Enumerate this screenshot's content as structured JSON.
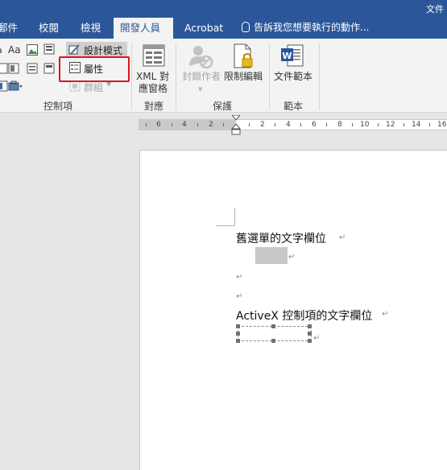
{
  "window": {
    "doc_title_fragment": "文件"
  },
  "tabs": [
    {
      "label": "郵件"
    },
    {
      "label": "校閱"
    },
    {
      "label": "檢視"
    },
    {
      "label": "開發人員",
      "active": true
    },
    {
      "label": "Acrobat"
    }
  ],
  "tell_me": {
    "text": "告訴我您想要執行的動作..."
  },
  "ribbon": {
    "controls": {
      "design_mode": "設計模式",
      "properties": "屬性",
      "group": "群組",
      "label": "控制項"
    },
    "mapping": {
      "xml_pane_line1": "XML 對",
      "xml_pane_line2": "應窗格",
      "label": "對應"
    },
    "protect": {
      "block_authors": "封鎖作者",
      "restrict_editing": "限制編輯",
      "label": "保護"
    },
    "templates": {
      "document_template": "文件範本",
      "label": "範本"
    }
  },
  "ruler": {
    "numbers": [
      "6",
      "4",
      "2",
      "2",
      "4",
      "6",
      "8",
      "10",
      "12",
      "14",
      "16"
    ]
  },
  "document": {
    "line1": "舊選單的文字欄位",
    "line2": "ActiveX 控制項的文字欄位"
  },
  "colors": {
    "ribbon_blue": "#2b579a",
    "highlight_red": "#e0141e",
    "word_blue": "#2b579a",
    "lock_gold": "#e8b820"
  },
  "icons": [
    "design-mode-icon",
    "properties-icon",
    "group-icon",
    "xml-pane-icon",
    "block-authors-icon",
    "restrict-editing-icon",
    "document-template-icon",
    "lightbulb-icon"
  ]
}
